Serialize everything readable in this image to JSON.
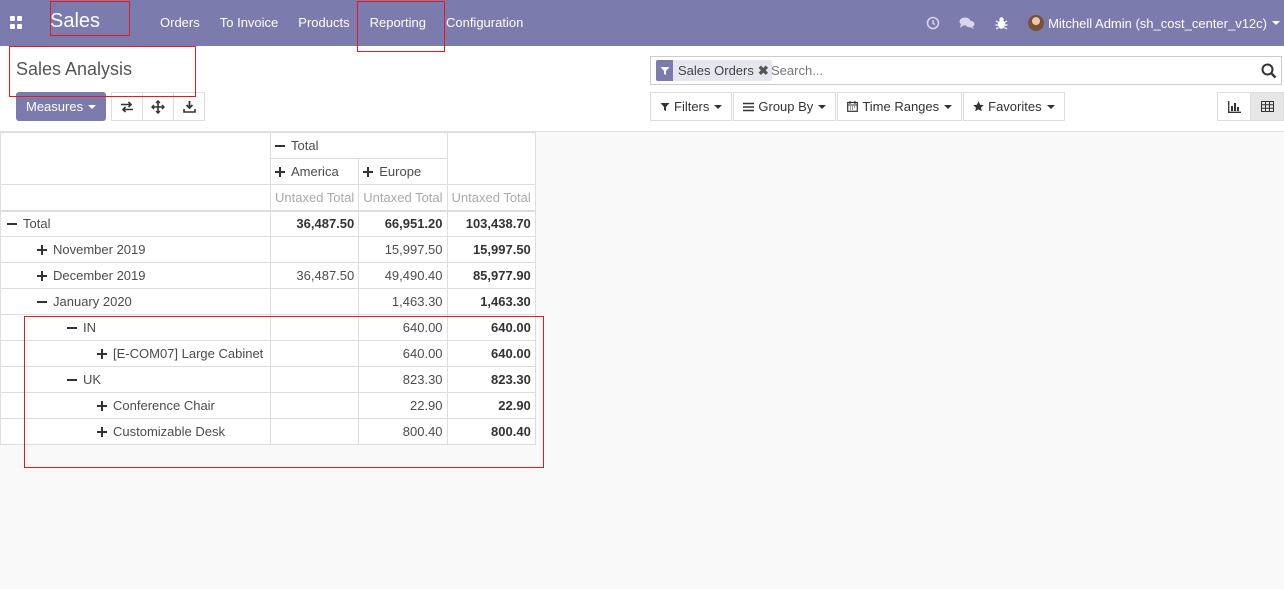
{
  "navbar": {
    "brand": "Sales",
    "menu": [
      "Orders",
      "To Invoice",
      "Products",
      "Reporting",
      "Configuration"
    ],
    "user": "Mitchell Admin (sh_cost_center_v12c)"
  },
  "control_panel": {
    "breadcrumb": "Sales Analysis",
    "measures_label": "Measures",
    "search": {
      "facet": "Sales Orders",
      "placeholder": "Search..."
    },
    "filters_label": "Filters",
    "group_by_label": "Group By",
    "time_ranges_label": "Time Ranges",
    "favorites_label": "Favorites"
  },
  "pivot": {
    "col_total": "Total",
    "col_groups": [
      "America",
      "Europe"
    ],
    "measure": "Untaxed Total",
    "rows": [
      {
        "label": "Total",
        "level": 0,
        "expanded": true,
        "america": "36,487.50",
        "europe": "66,951.20",
        "total": "103,438.70"
      },
      {
        "label": "November 2019",
        "level": 1,
        "expanded": false,
        "america": "",
        "europe": "15,997.50",
        "total": "15,997.50"
      },
      {
        "label": "December 2019",
        "level": 1,
        "expanded": false,
        "america": "36,487.50",
        "europe": "49,490.40",
        "total": "85,977.90"
      },
      {
        "label": "January 2020",
        "level": 1,
        "expanded": true,
        "america": "",
        "europe": "1,463.30",
        "total": "1,463.30"
      },
      {
        "label": "IN",
        "level": 2,
        "expanded": true,
        "america": "",
        "europe": "640.00",
        "total": "640.00"
      },
      {
        "label": "[E-COM07] Large Cabinet",
        "level": 3,
        "expanded": false,
        "america": "",
        "europe": "640.00",
        "total": "640.00"
      },
      {
        "label": "UK",
        "level": 2,
        "expanded": true,
        "america": "",
        "europe": "823.30",
        "total": "823.30"
      },
      {
        "label": "Conference Chair",
        "level": 3,
        "expanded": false,
        "america": "",
        "europe": "22.90",
        "total": "22.90"
      },
      {
        "label": "Customizable Desk",
        "level": 3,
        "expanded": false,
        "america": "",
        "europe": "800.40",
        "total": "800.40"
      }
    ]
  },
  "colors": {
    "navbar": "#7c7bad",
    "annotation": "#e01b24"
  }
}
